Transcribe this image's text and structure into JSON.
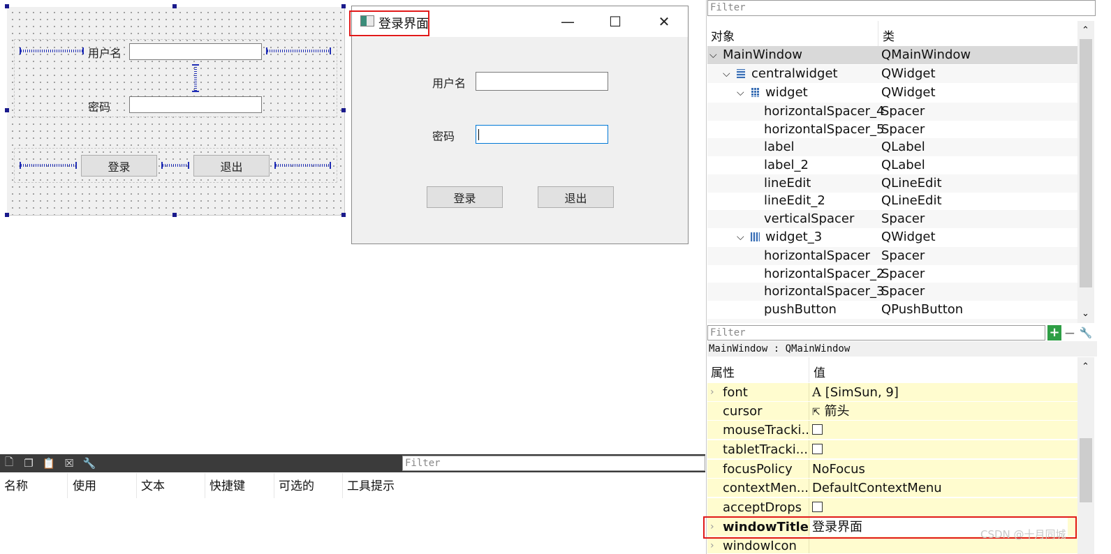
{
  "designer_form": {
    "username_label": "用户名",
    "password_label": "密码",
    "login_button": "登录",
    "exit_button": "退出"
  },
  "preview_window": {
    "title": "登录界面",
    "username_label": "用户名",
    "password_label": "密码",
    "login_button": "登录",
    "exit_button": "退出",
    "minimize_glyph": "—",
    "maximize_glyph": "☐",
    "close_glyph": "✕"
  },
  "object_inspector": {
    "filter_placeholder": "Filter",
    "col_object": "对象",
    "col_class": "类",
    "rows": [
      {
        "name": "MainWindow",
        "cls": "QMainWindow"
      },
      {
        "name": "centralwidget",
        "cls": "QWidget"
      },
      {
        "name": "widget",
        "cls": "QWidget"
      },
      {
        "name": "horizontalSpacer_4",
        "cls": "Spacer"
      },
      {
        "name": "horizontalSpacer_5",
        "cls": "Spacer"
      },
      {
        "name": "label",
        "cls": "QLabel"
      },
      {
        "name": "label_2",
        "cls": "QLabel"
      },
      {
        "name": "lineEdit",
        "cls": "QLineEdit"
      },
      {
        "name": "lineEdit_2",
        "cls": "QLineEdit"
      },
      {
        "name": "verticalSpacer",
        "cls": "Spacer"
      },
      {
        "name": "widget_3",
        "cls": "QWidget"
      },
      {
        "name": "horizontalSpacer",
        "cls": "Spacer"
      },
      {
        "name": "horizontalSpacer_2",
        "cls": "Spacer"
      },
      {
        "name": "horizontalSpacer_3",
        "cls": "Spacer"
      },
      {
        "name": "pushButton",
        "cls": "QPushButton"
      }
    ]
  },
  "property_editor": {
    "filter_placeholder": "Filter",
    "context": "MainWindow : QMainWindow",
    "col_property": "属性",
    "col_value": "值",
    "rows": [
      {
        "name": "font",
        "value": "[SimSun, 9]",
        "icon": "A"
      },
      {
        "name": "cursor",
        "value": "箭头",
        "icon": "⇱"
      },
      {
        "name": "mouseTracki...",
        "value": ""
      },
      {
        "name": "tabletTracki...",
        "value": ""
      },
      {
        "name": "focusPolicy",
        "value": "NoFocus"
      },
      {
        "name": "contextMen...",
        "value": "DefaultContextMenu"
      },
      {
        "name": "acceptDrops",
        "value": ""
      },
      {
        "name": "windowTitle",
        "value": "登录界面"
      },
      {
        "name": "windowIcon",
        "value": ""
      }
    ]
  },
  "action_editor": {
    "filter_placeholder": "Filter",
    "columns": [
      "名称",
      "使用",
      "文本",
      "快捷键",
      "可选的",
      "工具提示"
    ]
  },
  "watermark": "CSDN @十月同城",
  "colors": {
    "highlight_red": "#e11919",
    "spacer_blue": "#1f2db5",
    "property_yellow": "#fffccf"
  }
}
